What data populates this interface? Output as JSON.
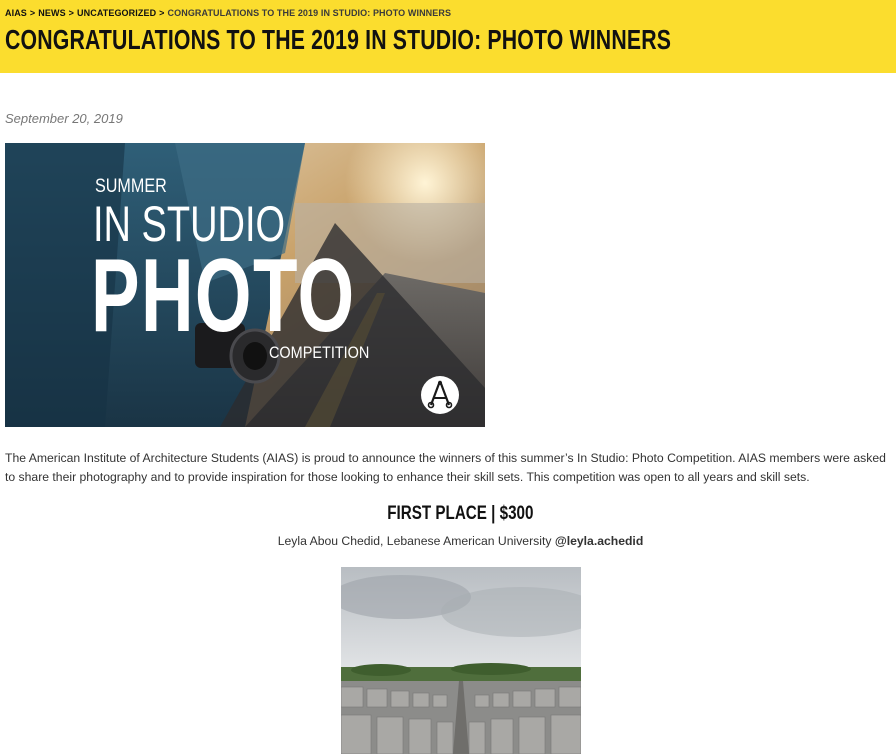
{
  "breadcrumb": {
    "items": [
      "AIAS",
      "NEWS",
      "UNCATEGORIZED"
    ],
    "separator": ">",
    "current": "CONGRATULATIONS TO THE 2019 IN STUDIO: PHOTO WINNERS"
  },
  "page": {
    "title": "CONGRATULATIONS TO THE 2019 IN STUDIO: PHOTO WINNERS",
    "date": "September 20, 2019"
  },
  "hero": {
    "line1": "SUMMER",
    "line2": "IN STUDIO",
    "line3": "PHOTO",
    "line4": "COMPETITION",
    "logo_icon": "aias-logo-icon"
  },
  "article": {
    "intro": "The American Institute of Architecture Students (AIAS) is proud to announce the winners of this summer’s In Studio: Photo Competition. AIAS members were asked to share their photography and to provide inspiration for those looking to enhance their skill sets. This competition was open to all years and skill sets.",
    "first_place": {
      "heading": "FIRST PLACE | $300",
      "winner": "Leyla Abou Chedid, Lebanese American University",
      "handle": "@leyla.achedid"
    }
  },
  "colors": {
    "banner": "#fbdd2e",
    "hero_dark": "#1f3a4a",
    "text": "#333333"
  }
}
